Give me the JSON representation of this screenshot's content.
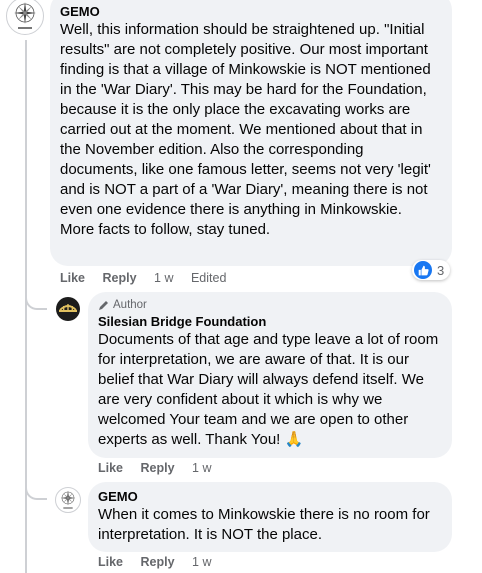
{
  "comments": [
    {
      "author": "GEMO",
      "text": "Well, this information should be straightened up. \"Initial results\" are not completely positive. Our most important finding is that a village of Minkowskie is NOT mentioned in the 'War Diary'. This may be hard for the Foundation, because it is the only place the excavating works are carried out at the moment. We mentioned about that in the November edition. Also the corresponding documents, like one famous letter, seems not very 'legit' and is NOT a part of a 'War Diary', meaning there is not even one evidence there is anything in Minkowskie. More facts to follow, stay tuned.",
      "actions": {
        "like": "Like",
        "reply": "Reply",
        "time": "1 w",
        "edited": "Edited"
      },
      "reaction_count": "3",
      "avatar_icon": "compass-rose-logo-icon"
    },
    {
      "badge": "Author",
      "badge_icon": "pen-icon",
      "author": "Silesian Bridge Foundation",
      "text": "Documents of that age and type leave a lot of room for interpretation, we are aware of that. It is our belief that War Diary will always defend itself. We are very confident about it which is why we welcomed Your team and we are open to other experts as well. Thank You! 🙏",
      "actions": {
        "like": "Like",
        "reply": "Reply",
        "time": "1 w"
      },
      "avatar_icon": "bridge-logo-icon"
    },
    {
      "author": "GEMO",
      "text": "When it comes to Minkowskie there is no room for interpretation. It is NOT the place.",
      "actions": {
        "like": "Like",
        "reply": "Reply",
        "time": "1 w"
      },
      "avatar_icon": "compass-rose-logo-icon"
    }
  ],
  "colors": {
    "bubble": "#f0f2f5",
    "text": "#050505",
    "secondary": "#65676b",
    "like_blue": "#1877f2",
    "thread_line": "#ced0d4"
  }
}
